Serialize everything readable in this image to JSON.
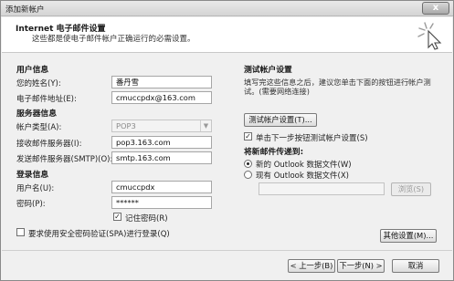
{
  "window": {
    "title": "添加新帐户",
    "close_label": "x"
  },
  "header": {
    "title": "Internet 电子邮件设置",
    "subtitle": "这些都是使电子邮件帐户正确运行的必需设置。",
    "icon": "cursor-click-icon"
  },
  "user_info": {
    "section": "用户信息",
    "name_label": "您的姓名(Y):",
    "name_value": "番丹雪",
    "email_label": "电子邮件地址(E):",
    "email_value": "cmuccpdx@163.com"
  },
  "server_info": {
    "section": "服务器信息",
    "account_type_label": "帐户类型(A):",
    "account_type_value": "POP3",
    "incoming_label": "接收邮件服务器(I):",
    "incoming_value": "pop3.163.com",
    "outgoing_label": "发送邮件服务器(SMTP)(O):",
    "outgoing_value": "smtp.163.com"
  },
  "login_info": {
    "section": "登录信息",
    "username_label": "用户名(U):",
    "username_value": "cmuccpdx",
    "password_label": "密码(P):",
    "password_value": "******",
    "remember_label": "记住密码(R)",
    "remember_checked": true,
    "spa_label": "要求使用安全密码验证(SPA)进行登录(Q)",
    "spa_checked": false
  },
  "test": {
    "section": "测试帐户设置",
    "description": "填写完这些信息之后，建议您单击下面的按钮进行帐户测试。(需要网络连接)",
    "test_button": "测试帐户设置(T)...",
    "auto_test_label": "单击下一步按钮测试帐户设置(S)",
    "auto_test_checked": true
  },
  "delivery": {
    "section": "将新邮件传递到:",
    "option_new": "新的 Outlook 数据文件(W)",
    "option_existing": "现有 Outlook 数据文件(X)",
    "selected": "new",
    "file_value": "",
    "browse_button": "浏览(S)"
  },
  "buttons": {
    "more_settings": "其他设置(M)...",
    "back": "< 上一步(B)",
    "next": "下一步(N) >",
    "cancel": "取消"
  }
}
